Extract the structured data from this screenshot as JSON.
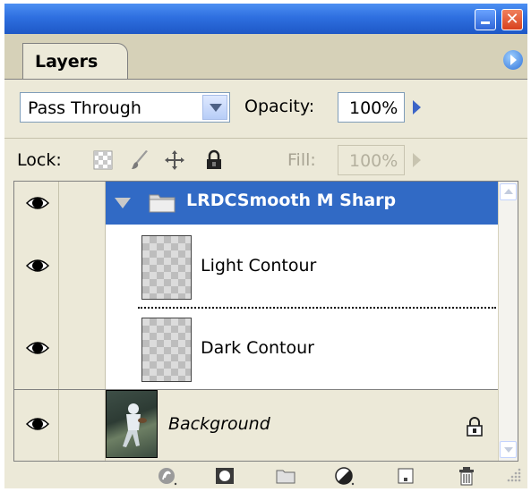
{
  "window": {
    "buttons": {
      "minimize_icon": "minimize-icon",
      "close_icon": "close-icon",
      "close_glyph": "✕"
    }
  },
  "panel": {
    "tab_label": "Layers",
    "menu_icon": "panel-menu-arrow-icon"
  },
  "blend": {
    "mode": "Pass Through",
    "opacity_label": "Opacity:",
    "opacity_value": "100%"
  },
  "lock": {
    "label": "Lock:",
    "icons": [
      "lock-transparency-icon",
      "lock-image-pixels-icon",
      "lock-position-icon",
      "lock-all-icon"
    ],
    "fill_label": "Fill:",
    "fill_value": "100%"
  },
  "layers": [
    {
      "type": "group",
      "name": "LRDCSmooth M Sharp",
      "visible": true,
      "selected": true,
      "expanded": true
    },
    {
      "type": "layer",
      "name": "Light Contour",
      "visible": true
    },
    {
      "type": "layer",
      "name": "Dark Contour",
      "visible": true
    },
    {
      "type": "layer",
      "name": "Background",
      "visible": true,
      "locked": true
    }
  ],
  "bottom_toolbar": [
    "link-layers-icon",
    "add-layer-mask-icon",
    "new-group-icon",
    "new-adjustment-layer-icon",
    "new-layer-icon",
    "delete-layer-icon"
  ],
  "colors": {
    "panel_bg": "#ece9d8",
    "selection": "#316ac5",
    "titlebar": "#2e6fe0"
  }
}
